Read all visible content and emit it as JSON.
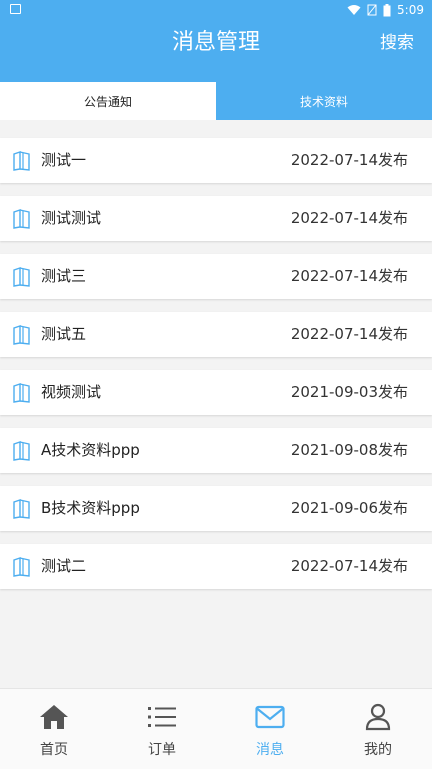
{
  "status_bar": {
    "time": "5:09"
  },
  "header": {
    "title": "消息管理",
    "search_label": "搜索"
  },
  "tabs": [
    {
      "label": "公告通知",
      "active": false
    },
    {
      "label": "技术资料",
      "active": true
    }
  ],
  "list": [
    {
      "title": "测试一",
      "date": "2022-07-14发布"
    },
    {
      "title": "测试测试",
      "date": "2022-07-14发布"
    },
    {
      "title": "测试三",
      "date": "2022-07-14发布"
    },
    {
      "title": "测试五",
      "date": "2022-07-14发布"
    },
    {
      "title": "视频测试",
      "date": "2021-09-03发布"
    },
    {
      "title": "A技术资料ppp",
      "date": "2021-09-08发布"
    },
    {
      "title": "B技术资料ppp",
      "date": "2021-09-06发布"
    },
    {
      "title": "测试二",
      "date": "2022-07-14发布"
    }
  ],
  "bottom_nav": [
    {
      "label": "首页",
      "icon": "home-icon",
      "active": false
    },
    {
      "label": "订单",
      "icon": "list-icon",
      "active": false
    },
    {
      "label": "消息",
      "icon": "mail-icon",
      "active": true
    },
    {
      "label": "我的",
      "icon": "user-icon",
      "active": false
    }
  ],
  "colors": {
    "accent": "#4daef0",
    "background": "#f3f3f3"
  }
}
